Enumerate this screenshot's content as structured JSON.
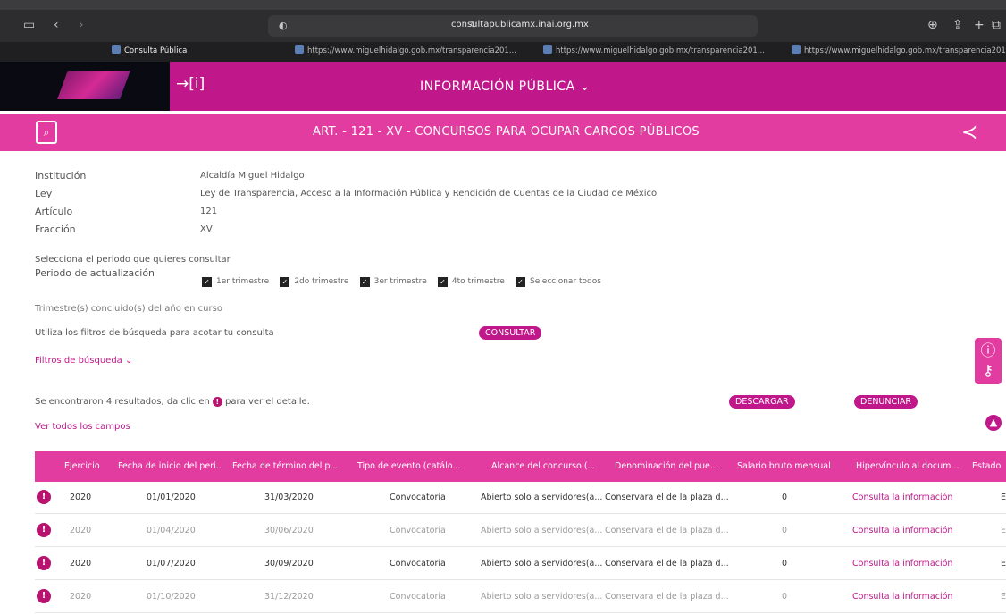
{
  "browser": {
    "url": "consultapublicamx.inai.org.mx",
    "tabs": [
      {
        "label": "Consulta Pública",
        "active": true
      },
      {
        "label": "https://www.miguelhidalgo.gob.mx/transparencia201...",
        "active": false
      },
      {
        "label": "https://www.miguelhidalgo.gob.mx/transparencia201...",
        "active": false
      },
      {
        "label": "https://www.miguelhidalgo.gob.mx/transparencia201...",
        "active": false
      }
    ]
  },
  "header": {
    "title": "INFORMACIÓN PÚBLICA ⌄"
  },
  "subheader": {
    "title": "ART. - 121 - XV - CONCURSOS PARA OCUPAR CARGOS PÚBLICOS"
  },
  "info": {
    "institucion_label": "Institución",
    "institucion_value": "Alcaldía Miguel Hidalgo",
    "ley_label": "Ley",
    "ley_value": "Ley de Transparencia, Acceso a la Información Pública y Rendición de Cuentas de la Ciudad de México",
    "articulo_label": "Artículo",
    "articulo_value": "121",
    "fraccion_label": "Fracción",
    "fraccion_value": "XV"
  },
  "periodo": {
    "prompt": "Selecciona el periodo que quieres consultar",
    "label": "Periodo de actualización",
    "options": [
      "1er trimestre",
      "2do trimestre",
      "3er trimestre",
      "4to trimestre",
      "Seleccionar todos"
    ]
  },
  "trimestres_text": "Trimestre(s) concluido(s) del año en curso",
  "filters_text": "Utiliza los filtros de búsqueda para acotar tu consulta",
  "consultar_label": "CONSULTAR",
  "filtros_label": "Filtros de búsqueda ⌄",
  "results_text_a": "Se encontraron ",
  "results_count": "4",
  "results_text_b": " resultados, da clic en ",
  "results_text_c": " para ver el detalle.",
  "descargar_label": "DESCARGAR",
  "denunciar_label": "DENUNCIAR",
  "ver_campos_label": "Ver todos los campos",
  "table": {
    "headers": [
      "Ejercicio",
      "Fecha de inicio del peri...",
      "Fecha de término del p...",
      "Tipo de evento (catálo...",
      "Alcance del concurso (...",
      "Denominación del pue...",
      "Salario bruto mensual",
      "Hipervínculo al docum...",
      "Estado"
    ],
    "rows": [
      {
        "ejercicio": "2020",
        "inicio": "01/01/2020",
        "termino": "31/03/2020",
        "tipo": "Convocatoria",
        "alcance": "Abierto solo a servidores(a...",
        "denominacion": "Conservara el de la plaza d...",
        "salario": "0",
        "link": "Consulta la información",
        "estado": "E"
      },
      {
        "ejercicio": "2020",
        "inicio": "01/04/2020",
        "termino": "30/06/2020",
        "tipo": "Convocatoria",
        "alcance": "Abierto solo a servidores(a...",
        "denominacion": "Conservara el de la plaza d...",
        "salario": "0",
        "link": "Consulta la información",
        "estado": "E"
      },
      {
        "ejercicio": "2020",
        "inicio": "01/07/2020",
        "termino": "30/09/2020",
        "tipo": "Convocatoria",
        "alcance": "Abierto solo a servidores(a...",
        "denominacion": "Conservara el de la plaza d...",
        "salario": "0",
        "link": "Consulta la información",
        "estado": "E"
      },
      {
        "ejercicio": "2020",
        "inicio": "01/10/2020",
        "termino": "31/12/2020",
        "tipo": "Convocatoria",
        "alcance": "Abierto solo a servidores(a...",
        "denominacion": "Conservara el de la plaza d...",
        "salario": "0",
        "link": "Consulta la información",
        "estado": "E"
      }
    ]
  },
  "colors": {
    "brand": "#c0188a",
    "brand_light": "#e23ca1"
  }
}
